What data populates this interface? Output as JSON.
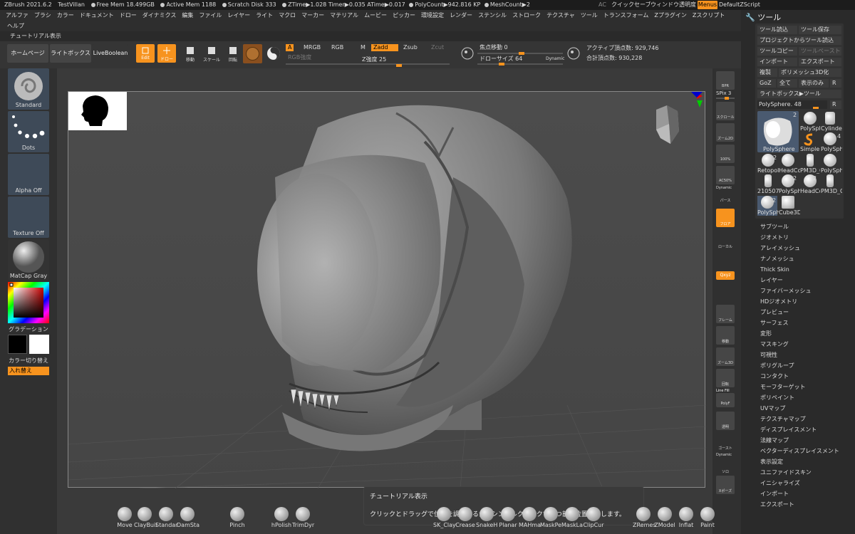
{
  "status": {
    "app": "ZBrush 2021.6.2",
    "project": "TestVillan",
    "free_mem": "Free Mem 18.499GB",
    "active_mem": "Active Mem 1188",
    "scratch": "Scratch Disk 333",
    "ztime": "ZTime▶1.028 Timer▶0.035 ATime▶0.017",
    "polycount": "PolyCount▶942.816 KP",
    "meshcount": "MeshCount▶2",
    "ac": "AC",
    "quicksave": "クイックセーブ",
    "window_trans": "ウィンドウ透明度",
    "menus": "Menus",
    "zscript": "DefaultZScript"
  },
  "menus": [
    "アルファ",
    "ブラシ",
    "カラー",
    "ドキュメント",
    "ドロー",
    "ダイナミクス",
    "編集",
    "ファイル",
    "レイヤー",
    "ライト",
    "マクロ",
    "マーカー",
    "マテリアル",
    "ムービー",
    "ピッカー",
    "環境設定",
    "レンダー",
    "ステンシル",
    "ストローク",
    "テクスチャ",
    "ツール",
    "トランスフォーム",
    "Zプラグイン",
    "Zスクリプト"
  ],
  "menu_help": "ヘルプ",
  "tutorial_label": "チュートリアル表示",
  "toolbar": {
    "home": "ホームページ",
    "lightbox": "ライトボックス",
    "liveboolean": "LiveBoolean",
    "edit": "Edit",
    "draw": "ドロー",
    "move": "移動",
    "scale": "スケール",
    "rotate": "回転",
    "a": "A",
    "mrgb": "MRGB",
    "rgb": "RGB",
    "m": "M",
    "zadd": "Zadd",
    "zsub": "Zsub",
    "zcut": "Zcut",
    "rgb_intensity": "RGB強度",
    "z_intensity": "Z強度 25",
    "focal": "焦点移動 0",
    "drawsize": "ドローサイズ 64",
    "dynamic": "Dynamic",
    "active_pts": "アクティブ頂点数: 929,746",
    "total_pts": "合計頂点数: 930,228"
  },
  "left": {
    "standard": "Standard",
    "dots": "Dots",
    "alpha": "Alpha Off",
    "texture": "Texture Off",
    "matcap": "MatCap Gray",
    "gradient": "グラデーション",
    "switch": "カラー切り替え",
    "swap": "入れ替え"
  },
  "right": {
    "bpr": "BPR",
    "spix": "SPix 3",
    "scroll": "スクロール",
    "zoom2d": "ズーム2D",
    "p100": "100%",
    "ac50": "AC50%",
    "dynamic": "Dynamic",
    "persp": "パース",
    "floor": "フロア",
    "local": "ローカル",
    "xyz": "Qxyz",
    "frame": "フレーム",
    "move": "移動",
    "zoom3d": "ズーム3D",
    "rotate": "回転",
    "linefill": "Line Fill",
    "polyf": "PolyF",
    "transp": "透明",
    "ghost": "ゴースト",
    "solo": "ソロ",
    "xpose": "Xポーズ"
  },
  "tool": {
    "title": "ツール",
    "load": "ツール読込",
    "save": "ツール保存",
    "proj_load": "プロジェクトからツール読込",
    "copy": "ツールコピー",
    "paste": "ツールペースト",
    "import": "インポート",
    "export": "エクスポート",
    "clone": "複製",
    "polymesh3d": "ポリメッシュ3D化",
    "goz": "GoZ",
    "all": "全て",
    "visible": "表示のみ",
    "r": "R",
    "lightbox_tool": "ライトボックス▶ツール",
    "polysphere": "PolySphere. 48",
    "meshes": [
      "PolySphere",
      "PolySph",
      "Cylinder",
      "SimpleB",
      "PolySph",
      "Retopol",
      "HeadCo",
      "PM3D_C",
      "PolySph",
      "210507",
      "PolySph",
      "HeadCo",
      "PM3D_C",
      "PolySph",
      "Cube3D"
    ],
    "counts": [
      "2",
      "4",
      "2",
      "2",
      "2",
      "2"
    ],
    "items": [
      "サブツール",
      "ジオメトリ",
      "アレイメッシュ",
      "ナノメッシュ",
      "Thick Skin",
      "レイヤー",
      "ファイバーメッシュ",
      "HDジオメトリ",
      "プレビュー",
      "サーフェス",
      "変形",
      "マスキング",
      "可視性",
      "ポリグループ",
      "コンタクト",
      "モーフターゲット",
      "ポリペイント",
      "UVマップ",
      "テクスチャマップ",
      "ディスプレイスメント",
      "法線マップ",
      "ベクターディスプレイスメント",
      "表示設定",
      "ユニファイドスキン",
      "イニシャライズ",
      "インポート",
      "エクスポート"
    ]
  },
  "tooltip": {
    "title": "チュートリアル表示",
    "body": "クリックとドラッグで位置を調整するか、シングルクリックで一つ前の位置に戻します。"
  },
  "shelf": [
    "Move",
    "ClayBuil",
    "Standar",
    "DamSta",
    "Pinch",
    "hPolish",
    "TrimDyr",
    "SK_Clay",
    "Crease",
    "SnakeH",
    "Planar",
    "MAHma",
    "MaskPe",
    "MaskLa",
    "ClipCur",
    "ZRemes",
    "ZModel",
    "Inflat",
    "Paint"
  ]
}
